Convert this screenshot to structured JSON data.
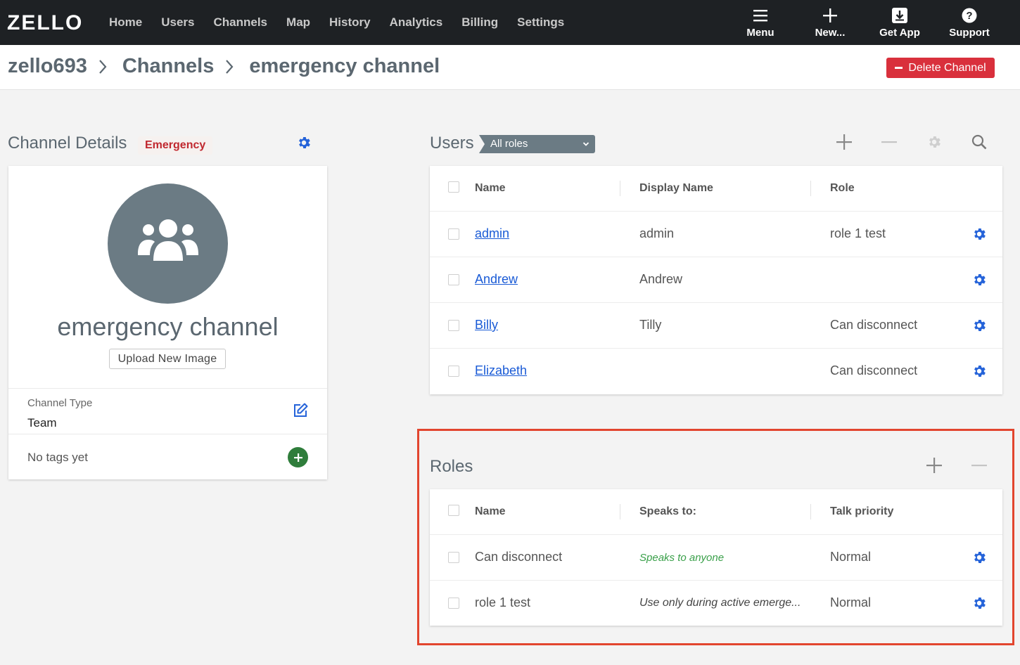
{
  "nav": {
    "logo": "ZELLO",
    "links": [
      "Home",
      "Users",
      "Channels",
      "Map",
      "History",
      "Analytics",
      "Billing",
      "Settings"
    ],
    "actions": [
      {
        "label": "Menu",
        "icon": "hamburger-icon"
      },
      {
        "label": "New...",
        "icon": "plus-icon"
      },
      {
        "label": "Get App",
        "icon": "download-icon"
      },
      {
        "label": "Support",
        "icon": "help-icon"
      }
    ]
  },
  "breadcrumb": [
    "zello693",
    "Channels",
    "emergency channel"
  ],
  "delete_button": "Delete Channel",
  "channel_details": {
    "title": "Channel Details",
    "badge": "Emergency",
    "name": "emergency channel",
    "upload_button": "Upload New Image",
    "type_label": "Channel Type",
    "type_value": "Team",
    "tags_text": "No tags yet"
  },
  "users": {
    "title": "Users",
    "role_filter": "All roles",
    "columns": [
      "Name",
      "Display Name",
      "Role"
    ],
    "rows": [
      {
        "name": "admin",
        "display": "admin",
        "role": "role 1 test"
      },
      {
        "name": "Andrew",
        "display": "Andrew",
        "role": ""
      },
      {
        "name": "Billy",
        "display": "Tilly",
        "role": "Can disconnect"
      },
      {
        "name": "Elizabeth",
        "display": "",
        "role": "Can disconnect"
      }
    ]
  },
  "roles": {
    "title": "Roles",
    "columns": [
      "Name",
      "Speaks to:",
      "Talk priority"
    ],
    "rows": [
      {
        "name": "Can disconnect",
        "speaks": "Speaks to anyone",
        "priority": "Normal"
      },
      {
        "name": "role 1 test",
        "speaks": "Use only during active emerge...",
        "priority": "Normal"
      }
    ]
  },
  "colors": {
    "nav_bg": "#1e2124",
    "accent_blue": "#1a5bd6",
    "danger": "#d9303c",
    "highlight": "#e2452e",
    "success": "#2f7d3b"
  }
}
